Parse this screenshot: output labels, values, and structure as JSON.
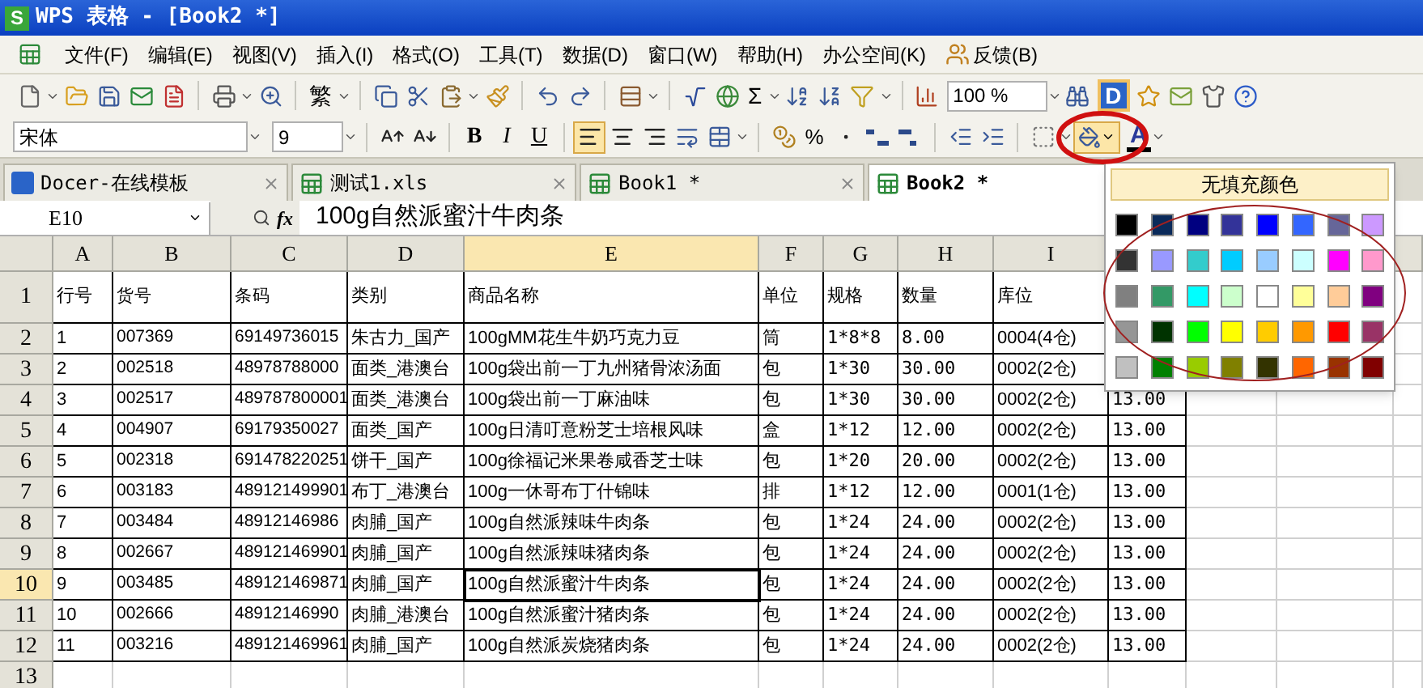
{
  "window": {
    "title": "WPS 表格 - [Book2 *]",
    "app_badge": "S"
  },
  "menu": [
    "文件(F)",
    "编辑(E)",
    "视图(V)",
    "插入(I)",
    "格式(O)",
    "工具(T)",
    "数据(D)",
    "窗口(W)",
    "帮助(H)",
    "办公空间(K)",
    "反馈(B)"
  ],
  "toolbar": {
    "traditional": "繁",
    "sum": "Σ",
    "zoom": "100 %",
    "docer": "D"
  },
  "format_bar": {
    "font": "宋体",
    "size": "9",
    "bold": "B",
    "italic": "I",
    "underline": "U",
    "percent": "%",
    "font_color": "A",
    "align": [
      {
        "selected": true
      },
      {
        "selected": false
      },
      {
        "selected": false
      }
    ]
  },
  "tabs": [
    {
      "label": "Docer-在线模板",
      "kind": "docer",
      "selected": false
    },
    {
      "label": "测试1.xls",
      "kind": "sheet",
      "selected": false
    },
    {
      "label": "Book1 *",
      "kind": "sheet",
      "selected": false
    },
    {
      "label": "Book2 *",
      "kind": "sheet",
      "selected": true
    }
  ],
  "formula_bar": {
    "cell": "E10",
    "fx": "fx",
    "value": "100g自然派蜜汁牛肉条"
  },
  "sheet": {
    "columns": [
      {
        "label": "A",
        "selected": false
      },
      {
        "label": "B",
        "selected": false
      },
      {
        "label": "C",
        "selected": false
      },
      {
        "label": "D",
        "selected": false
      },
      {
        "label": "E",
        "selected": true
      },
      {
        "label": "F",
        "selected": false
      },
      {
        "label": "G",
        "selected": false
      },
      {
        "label": "H",
        "selected": false
      },
      {
        "label": "I",
        "selected": false
      }
    ],
    "rows": [
      {
        "label": "1",
        "selected": false,
        "cells": [
          "行号",
          "货号",
          "条码",
          "类别",
          "商品名称",
          "单位",
          "规格",
          "数量",
          "库位"
        ]
      },
      {
        "label": "2",
        "selected": false,
        "cells": [
          "1",
          "007369",
          "69149736015",
          "朱古力_国产",
          "100gMM花生牛奶巧克力豆",
          "筒",
          "1*8*8",
          "8.00",
          "0004(4仓)"
        ]
      },
      {
        "label": "3",
        "selected": false,
        "cells": [
          "2",
          "002518",
          "48978788000",
          "面类_港澳台",
          "100g袋出前一丁九州猪骨浓汤面",
          "包",
          "1*30",
          "30.00",
          "0002(2仓)"
        ]
      },
      {
        "label": "4",
        "selected": false,
        "cells": [
          "3",
          "002517",
          "489787800001",
          "面类_港澳台",
          "100g袋出前一丁麻油味",
          "包",
          "1*30",
          "30.00",
          "0002(2仓)",
          "13.00"
        ]
      },
      {
        "label": "5",
        "selected": false,
        "cells": [
          "4",
          "004907",
          "69179350027",
          "面类_国产",
          "100g日清叮意粉芝士培根风味",
          "盒",
          "1*12",
          "12.00",
          "0002(2仓)",
          "13.00"
        ]
      },
      {
        "label": "6",
        "selected": false,
        "cells": [
          "5",
          "002318",
          "691478220251",
          "饼干_国产",
          "100g徐福记米果卷咸香芝士味",
          "包",
          "1*20",
          "20.00",
          "0002(2仓)",
          "13.00"
        ]
      },
      {
        "label": "7",
        "selected": false,
        "cells": [
          "6",
          "003183",
          "489121499901",
          "布丁_港澳台",
          "100g一休哥布丁什锦味",
          "排",
          "1*12",
          "12.00",
          "0001(1仓)",
          "13.00"
        ]
      },
      {
        "label": "8",
        "selected": false,
        "cells": [
          "7",
          "003484",
          "48912146986",
          "肉脯_国产",
          "100g自然派辣味牛肉条",
          "包",
          "1*24",
          "24.00",
          "0002(2仓)",
          "13.00"
        ]
      },
      {
        "label": "9",
        "selected": false,
        "cells": [
          "8",
          "002667",
          "489121469901",
          "肉脯_国产",
          "100g自然派辣味猪肉条",
          "包",
          "1*24",
          "24.00",
          "0002(2仓)",
          "13.00"
        ]
      },
      {
        "label": "10",
        "selected": true,
        "cells": [
          "9",
          "003485",
          "489121469871",
          "肉脯_国产",
          "100g自然派蜜汁牛肉条",
          "包",
          "1*24",
          "24.00",
          "0002(2仓)",
          "13.00"
        ]
      },
      {
        "label": "11",
        "selected": false,
        "cells": [
          "10",
          "002666",
          "48912146990",
          "肉脯_港澳台",
          "100g自然派蜜汁猪肉条",
          "包",
          "1*24",
          "24.00",
          "0002(2仓)",
          "13.00"
        ]
      },
      {
        "label": "12",
        "selected": false,
        "cells": [
          "11",
          "003216",
          "489121469961",
          "肉脯_国产",
          "100g自然派炭烧猪肉条",
          "包",
          "1*24",
          "24.00",
          "0002(2仓)",
          "13.00"
        ]
      },
      {
        "label": "13",
        "selected": false
      }
    ]
  },
  "fill_menu": {
    "title": "无填充颜色",
    "swatches": [
      {
        "color": "#000000"
      },
      {
        "color": "#0a2a5a"
      },
      {
        "color": "#000080"
      },
      {
        "color": "#333399"
      },
      {
        "color": "#0000ff"
      },
      {
        "color": "#3366ff"
      },
      {
        "color": "#666699"
      },
      {
        "color": "#cc99ff"
      },
      {
        "color": "#333333"
      },
      {
        "color": "#9999ff"
      },
      {
        "color": "#33cccc"
      },
      {
        "color": "#00ccff"
      },
      {
        "color": "#99ccff"
      },
      {
        "color": "#ccffff"
      },
      {
        "color": "#ff00ff"
      },
      {
        "color": "#ff99cc"
      },
      {
        "color": "#808080"
      },
      {
        "color": "#339966"
      },
      {
        "color": "#00ffff"
      },
      {
        "color": "#ccffcc"
      },
      {
        "color": "#ffffff"
      },
      {
        "color": "#ffff99"
      },
      {
        "color": "#ffcc99"
      },
      {
        "color": "#800080"
      },
      {
        "color": "#969696"
      },
      {
        "color": "#003300"
      },
      {
        "color": "#00ff00"
      },
      {
        "color": "#ffff00"
      },
      {
        "color": "#ffcc00"
      },
      {
        "color": "#ff9900"
      },
      {
        "color": "#ff0000"
      },
      {
        "color": "#993366"
      },
      {
        "color": "#c0c0c0"
      },
      {
        "color": "#008000"
      },
      {
        "color": "#99cc00"
      },
      {
        "color": "#808000"
      },
      {
        "color": "#333300"
      },
      {
        "color": "#ff6600"
      },
      {
        "color": "#993300"
      },
      {
        "color": "#800000"
      }
    ]
  }
}
